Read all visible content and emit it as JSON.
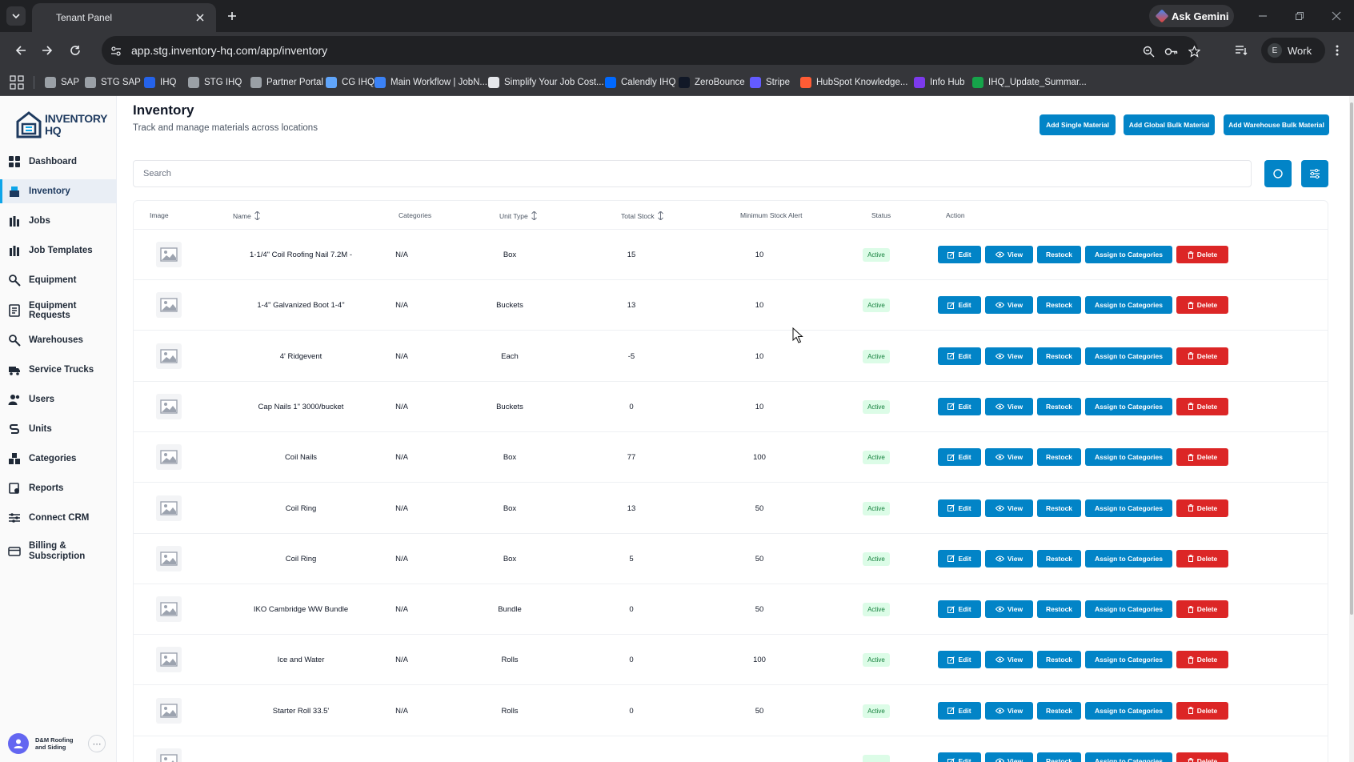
{
  "browser": {
    "tab_title": "Tenant Panel",
    "url": "app.stg.inventory-hq.com/app/inventory",
    "gemini_label": "Ask Gemini",
    "profile_initial": "E",
    "profile_label": "Work",
    "bookmarks": [
      {
        "label": "SAP",
        "color": "#9aa0a6"
      },
      {
        "label": "STG SAP",
        "color": "#9aa0a6"
      },
      {
        "label": "IHQ",
        "color": "#2563eb"
      },
      {
        "label": "STG IHQ",
        "color": "#9aa0a6"
      },
      {
        "label": "Partner Portal",
        "color": "#9aa0a6"
      },
      {
        "label": "CG IHQ",
        "color": "#60a5fa"
      },
      {
        "label": "Main Workflow | JobN...",
        "color": "#3b82f6"
      },
      {
        "label": "Simplify Your Job Cost...",
        "color": "#e5e7eb"
      },
      {
        "label": "Calendly IHQ",
        "color": "#0069ff"
      },
      {
        "label": "ZeroBounce",
        "color": "#111827"
      },
      {
        "label": "Stripe",
        "color": "#635bff"
      },
      {
        "label": "HubSpot Knowledge...",
        "color": "#ff5c35"
      },
      {
        "label": "Info Hub",
        "color": "#7c3aed"
      },
      {
        "label": "IHQ_Update_Summar...",
        "color": "#16a34a"
      }
    ]
  },
  "sidebar": {
    "logo_line1": "INVENTORY",
    "logo_line2": "HQ",
    "items": [
      {
        "label": "Dashboard",
        "icon": "dashboard-icon",
        "active": false
      },
      {
        "label": "Inventory",
        "icon": "inventory-icon",
        "active": true
      },
      {
        "label": "Jobs",
        "icon": "jobs-icon",
        "active": false
      },
      {
        "label": "Job Templates",
        "icon": "job-templates-icon",
        "active": false
      },
      {
        "label": "Equipment",
        "icon": "equipment-icon",
        "active": false
      },
      {
        "label": "Equipment Requests",
        "icon": "equipment-requests-icon",
        "active": false
      },
      {
        "label": "Warehouses",
        "icon": "warehouses-icon",
        "active": false
      },
      {
        "label": "Service Trucks",
        "icon": "truck-icon",
        "active": false
      },
      {
        "label": "Users",
        "icon": "users-icon",
        "active": false
      },
      {
        "label": "Units",
        "icon": "units-icon",
        "active": false
      },
      {
        "label": "Categories",
        "icon": "categories-icon",
        "active": false
      },
      {
        "label": "Reports",
        "icon": "reports-icon",
        "active": false
      },
      {
        "label": "Connect CRM",
        "icon": "connect-crm-icon",
        "active": false
      },
      {
        "label": "Billing & Subscription",
        "icon": "billing-icon",
        "active": false
      }
    ],
    "org_name": "D&M Roofing and Siding"
  },
  "header": {
    "title": "Inventory",
    "subtitle": "Track and manage materials across locations",
    "btn_single": "Add Single Material",
    "btn_global": "Add Global Bulk Material",
    "btn_warehouse": "Add Warehouse Bulk Material"
  },
  "search": {
    "placeholder": "Search"
  },
  "table": {
    "columns": {
      "image": "Image",
      "name": "Name",
      "categories": "Categories",
      "unit_type": "Unit Type",
      "total_stock": "Total Stock",
      "min_alert": "Minimum Stock Alert",
      "status": "Status",
      "action": "Action"
    },
    "actions": {
      "edit": "Edit",
      "view": "View",
      "restock": "Restock",
      "assign": "Assign to Categories",
      "delete": "Delete"
    },
    "rows": [
      {
        "name": "1-1/4\" Coil Roofing Nail 7.2M -",
        "categories": "N/A",
        "unit": "Box",
        "stock": "15",
        "min": "10",
        "status": "Active"
      },
      {
        "name": "1-4\" Galvanized Boot 1-4\"",
        "categories": "N/A",
        "unit": "Buckets",
        "stock": "13",
        "min": "10",
        "status": "Active"
      },
      {
        "name": "4' Ridgevent",
        "categories": "N/A",
        "unit": "Each",
        "stock": "-5",
        "min": "10",
        "status": "Active"
      },
      {
        "name": "Cap Nails 1\" 3000/bucket",
        "categories": "N/A",
        "unit": "Buckets",
        "stock": "0",
        "min": "10",
        "status": "Active"
      },
      {
        "name": "Coil Nails",
        "categories": "N/A",
        "unit": "Box",
        "stock": "77",
        "min": "100",
        "status": "Active"
      },
      {
        "name": "Coil Ring",
        "categories": "N/A",
        "unit": "Box",
        "stock": "13",
        "min": "50",
        "status": "Active"
      },
      {
        "name": "Coil Ring",
        "categories": "N/A",
        "unit": "Box",
        "stock": "5",
        "min": "50",
        "status": "Active"
      },
      {
        "name": "IKO Cambridge WW Bundle",
        "categories": "N/A",
        "unit": "Bundle",
        "stock": "0",
        "min": "50",
        "status": "Active"
      },
      {
        "name": "Ice and Water",
        "categories": "N/A",
        "unit": "Rolls",
        "stock": "0",
        "min": "100",
        "status": "Active"
      },
      {
        "name": "Starter Roll 33.5'",
        "categories": "N/A",
        "unit": "Rolls",
        "stock": "0",
        "min": "50",
        "status": "Active"
      },
      {
        "name": "",
        "categories": "",
        "unit": "",
        "stock": "",
        "min": "",
        "status": ""
      }
    ]
  },
  "colors": {
    "primary": "#0284c7",
    "danger": "#dc2626",
    "active_badge_bg": "#dcfce7",
    "active_badge_text": "#15803d"
  }
}
